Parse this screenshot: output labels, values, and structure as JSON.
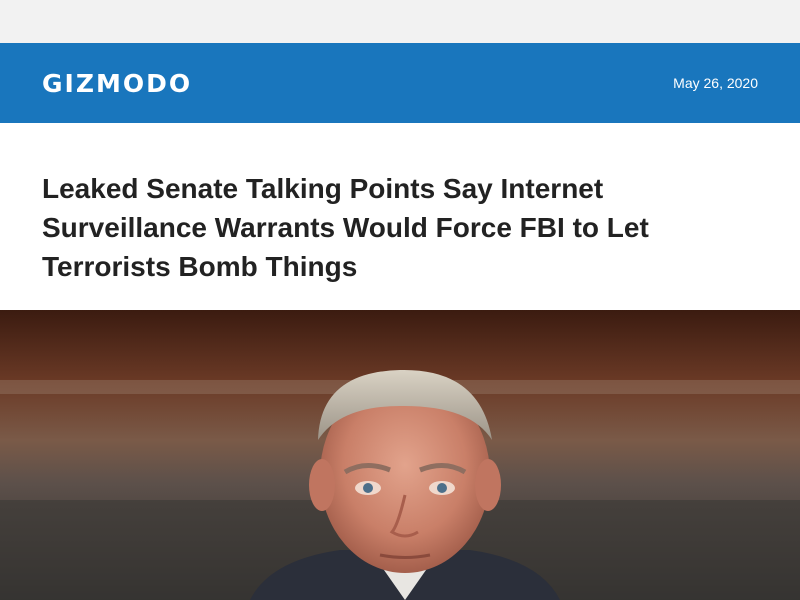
{
  "site": {
    "logo": "GIZMODO",
    "date": "May 26, 2020",
    "brand_color": "#1976bd"
  },
  "article": {
    "headline": "Leaked Senate Talking Points Say Internet Surveillance Warrants Would Force FBI to Let Terrorists Bomb Things"
  },
  "hero_image": {
    "icon": "photo-of-senator"
  }
}
